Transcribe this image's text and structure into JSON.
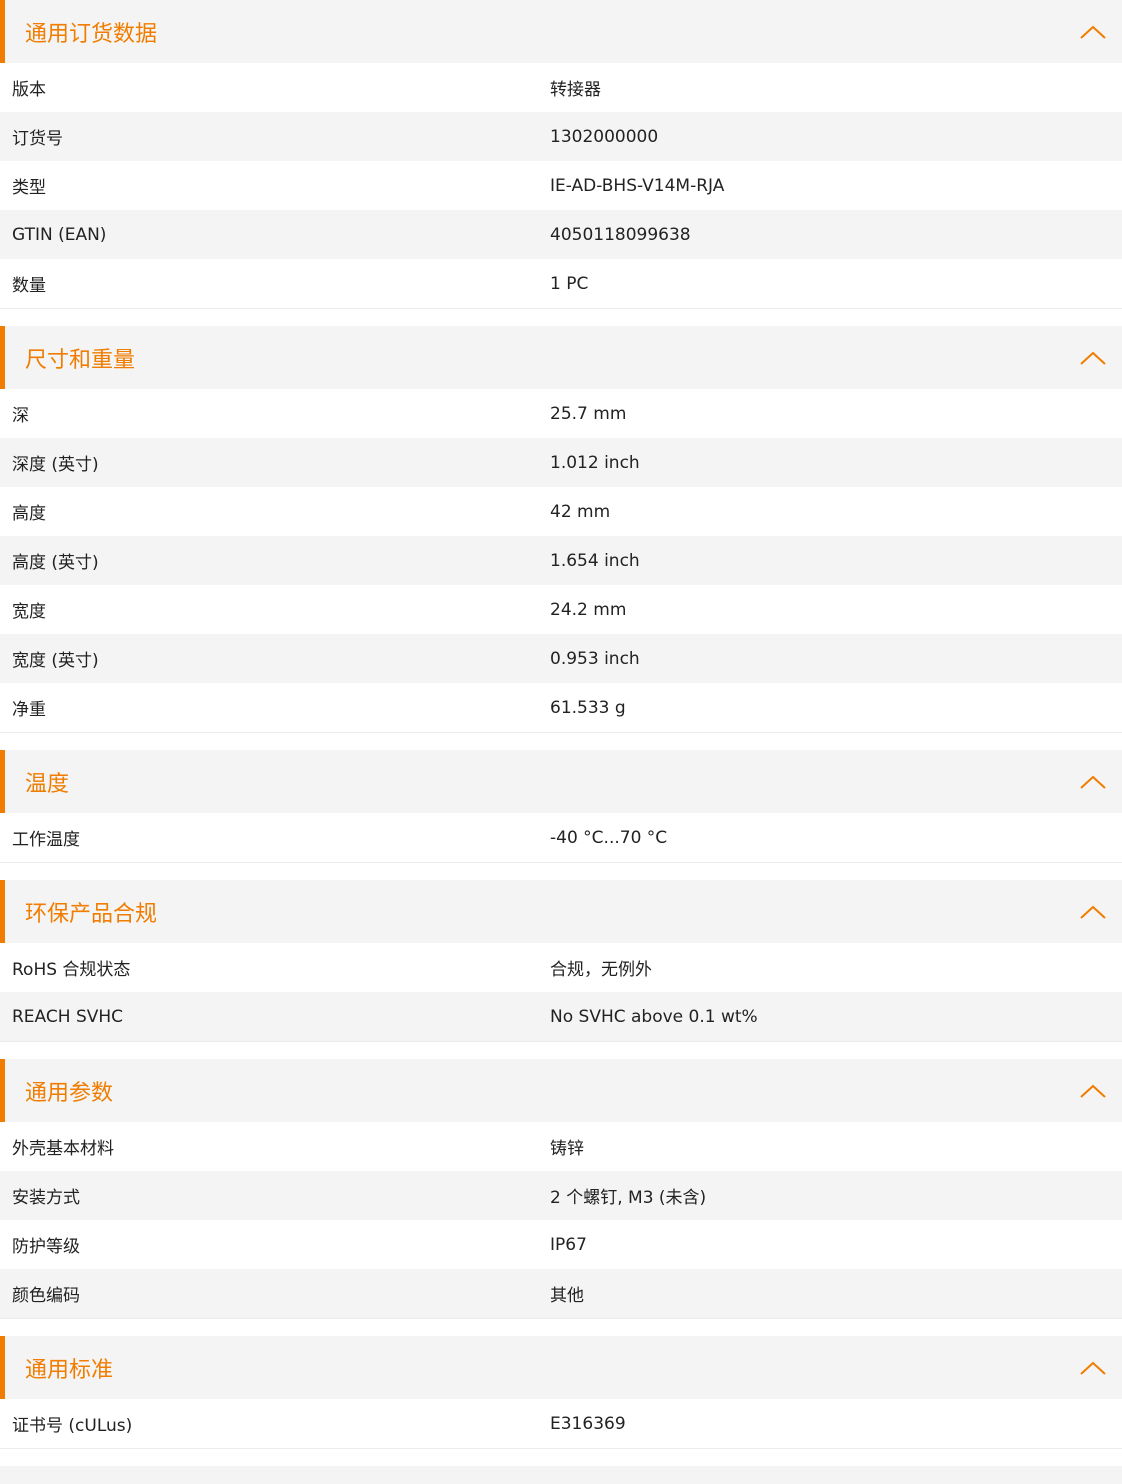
{
  "accent_color": "#f07d00",
  "chevron_icon": "chevron-up-icon",
  "sections": [
    {
      "title": "通用订货数据",
      "rows": [
        {
          "label": "版本",
          "value": "转接器"
        },
        {
          "label": "订货号",
          "value": "1302000000"
        },
        {
          "label": "类型",
          "value": "IE-AD-BHS-V14M-RJA"
        },
        {
          "label": "GTIN (EAN)",
          "value": "4050118099638"
        },
        {
          "label": "数量",
          "value": "1  PC"
        }
      ]
    },
    {
      "title": "尺寸和重量",
      "rows": [
        {
          "label": "深",
          "value": "25.7  mm"
        },
        {
          "label": "深度 (英寸)",
          "value": "1.012  inch"
        },
        {
          "label": "高度",
          "value": "42  mm"
        },
        {
          "label": "高度 (英寸)",
          "value": "1.654  inch"
        },
        {
          "label": "宽度",
          "value": "24.2  mm"
        },
        {
          "label": "宽度 (英寸)",
          "value": "0.953  inch"
        },
        {
          "label": "净重",
          "value": "61.533  g"
        }
      ]
    },
    {
      "title": "温度",
      "rows": [
        {
          "label": "工作温度",
          "value": "-40 °C...70 °C"
        }
      ]
    },
    {
      "title": "环保产品合规",
      "rows": [
        {
          "label": "RoHS 合规状态",
          "value": "合规，无例外"
        },
        {
          "label": "REACH SVHC",
          "value": "No SVHC above 0.1 wt%"
        }
      ]
    },
    {
      "title": "通用参数",
      "rows": [
        {
          "label": "外壳基本材料",
          "value": "铸锌"
        },
        {
          "label": "安装方式",
          "value": "2 个螺钉, M3 (未含)"
        },
        {
          "label": "防护等级",
          "value": "IP67"
        },
        {
          "label": "颜色编码",
          "value": "其他"
        }
      ]
    },
    {
      "title": "通用标准",
      "rows": [
        {
          "label": "证书号 (cULus)",
          "value": "E316369"
        }
      ]
    }
  ]
}
